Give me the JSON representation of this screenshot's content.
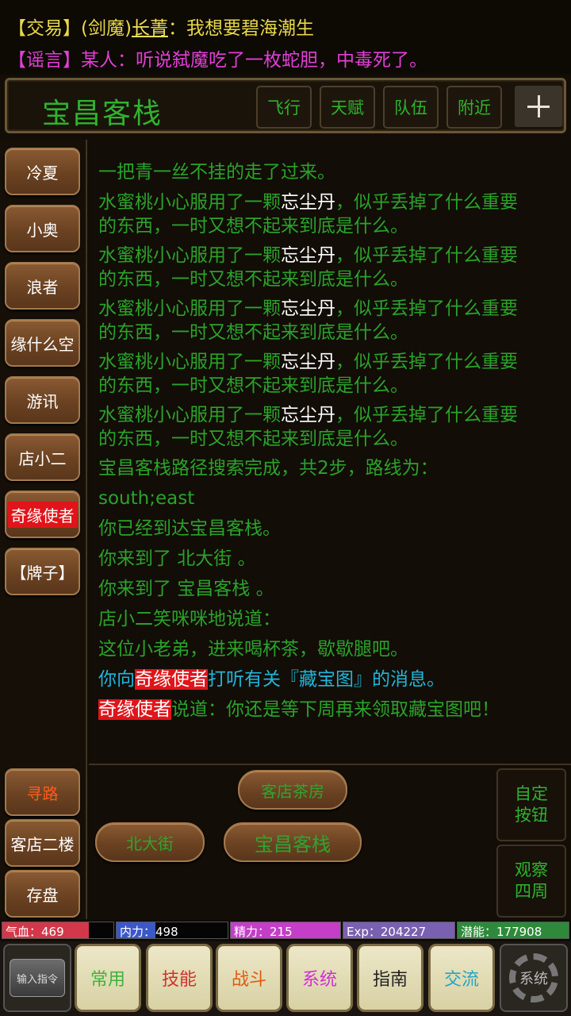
{
  "broadcast": {
    "trade": {
      "tag": "【交易】",
      "faction": "(剑魔)",
      "player": "长菁",
      "sep": "：",
      "text": "我想要碧海潮生"
    },
    "rumor": {
      "tag": "【谣言】",
      "text": "某人：听说弑魔吃了一枚蛇胆，中毒死了。"
    }
  },
  "header": {
    "room_title": "宝昌客栈",
    "buttons": [
      "飞行",
      "天赋",
      "队伍",
      "附近"
    ]
  },
  "left_players": [
    "冷夏",
    "小奥",
    "浪者",
    "缘什么空",
    "游讯",
    "店小二",
    "奇缘使者",
    "【牌子】"
  ],
  "left_actions": [
    "寻路",
    "客店二楼",
    "存盘"
  ],
  "chat": {
    "line0": "一把青一丝不挂的走了过来。",
    "pill_a": "水蜜桃小心服用了一颗",
    "pill_item": "忘尘丹",
    "pill_b": "，似乎丢掉了什么重要",
    "pill_c": "的东西，一时又想不起来到底是什么。",
    "path": "宝昌客栈路径搜索完成，共2步，路线为：",
    "route": "south;east",
    "arrive": "你已经到达宝昌客栈。",
    "came1": "你来到了 北大街 。",
    "came2": "你来到了 宝昌客栈 。",
    "waiter": "店小二笑咪咪地说道：",
    "waiter_say": "这位小老弟，进来喝杯茶，歇歇腿吧。",
    "ask_a": "你向",
    "ask_name": "奇缘使者",
    "ask_b": "打听有关『藏宝图』的消息。",
    "reply_name": "奇缘使者",
    "reply_text": "说道：你还是等下周再来领取藏宝图吧！"
  },
  "exits": {
    "north": "客店茶房",
    "west": "北大街",
    "current": "宝昌客栈",
    "custom": "自定\n按钮",
    "look": "观察\n四周"
  },
  "stats": {
    "hp": {
      "label": "气血：469",
      "fill": 0.78,
      "color": "#d2384a"
    },
    "mp": {
      "label": "内力：498",
      "fill": 0.35,
      "color": "#3a58c8"
    },
    "jing": {
      "label": "精力：215",
      "fill": 1.0,
      "color": "#c43ec8"
    },
    "exp": {
      "label": "Exp：204227",
      "fill": 1.0,
      "color": "#7a60b0"
    },
    "pot": {
      "label": "潜能：177908",
      "fill": 1.0,
      "color": "#2e8a3a"
    }
  },
  "bottom": {
    "cmd": "输入指令",
    "tabs": [
      {
        "label": "常用",
        "color": "#3fb23f"
      },
      {
        "label": "技能",
        "color": "#d03030"
      },
      {
        "label": "战斗",
        "color": "#e05a12"
      },
      {
        "label": "系统",
        "color": "#d32fd3"
      },
      {
        "label": "指南",
        "color": "#222222"
      },
      {
        "label": "交流",
        "color": "#1fa7c6"
      }
    ],
    "gear": "系统"
  }
}
